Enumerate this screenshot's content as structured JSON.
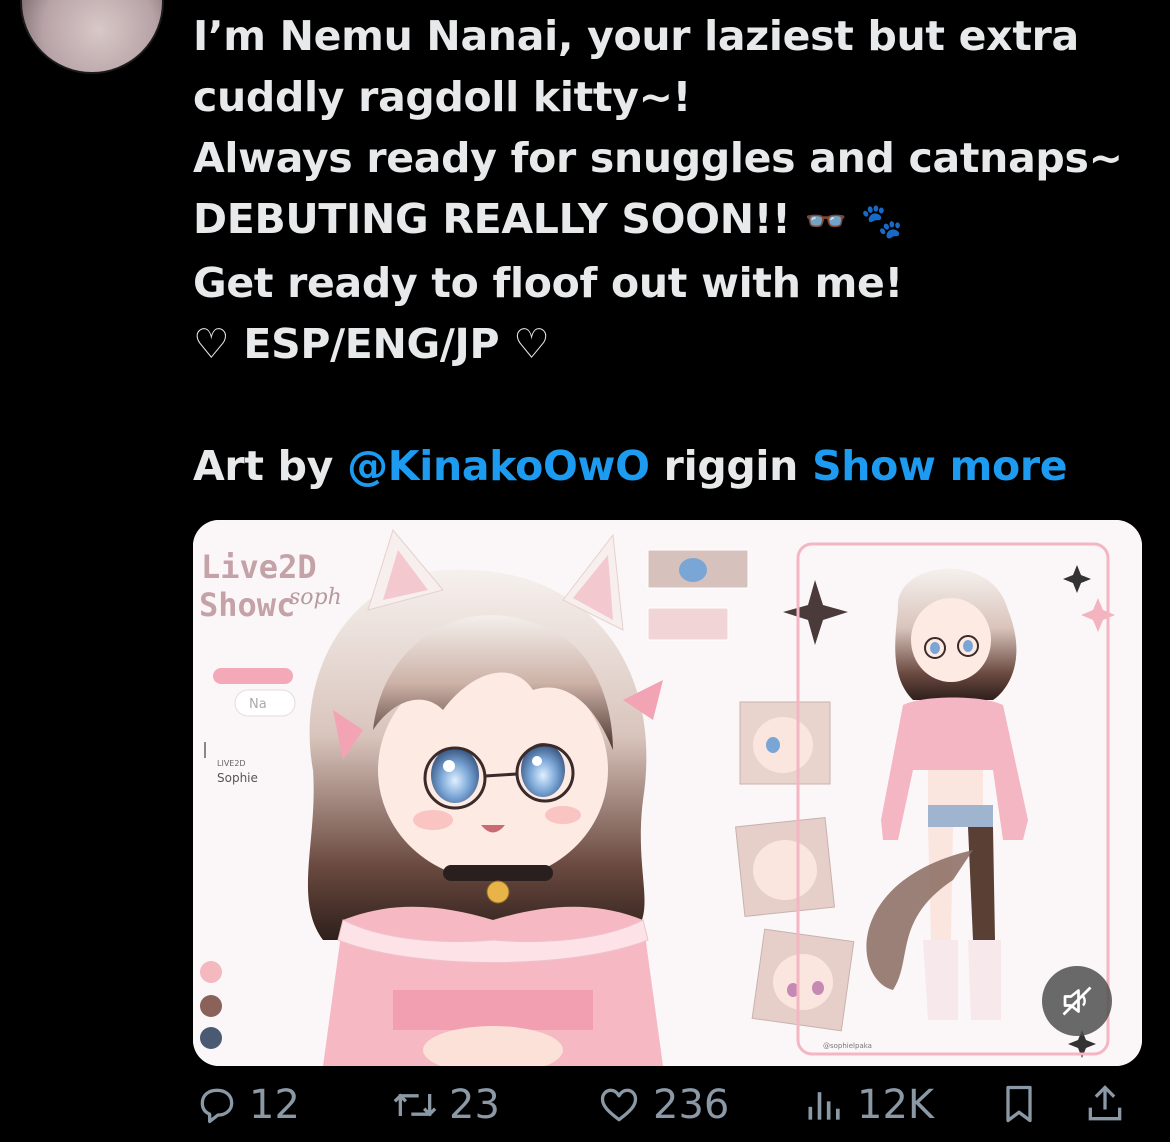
{
  "tweet": {
    "lines": [
      "I’m Nemu Nanai, your laziest but extra",
      "cuddly ragdoll kitty~!",
      "Always ready for snuggles and catnaps~",
      "DEBUTING REALLY SOON!! ",
      "Get ready to floof out with me!",
      "♡ ESP/ENG/JP ♡"
    ],
    "glasses_emoji": "👓",
    "paw_emoji": "🐾",
    "art_by_prefix": "Art by ",
    "mention": "@KinakoOwO",
    "after_mention": " riggin ",
    "show_more": "Show more"
  },
  "media": {
    "title_line1": "Live2D",
    "title_line2": "Showc",
    "script_overlay": "soph",
    "name_field": "Na",
    "credit_small": "LIVE2D",
    "credit_name": "Sophie",
    "watermark": "@sophielpaka",
    "swatches": [
      "#f4b9bf",
      "#8a6259",
      "#4b5a73"
    ]
  },
  "actions": {
    "replies": "12",
    "reposts": "23",
    "likes": "236",
    "views": "12K"
  },
  "colors": {
    "background": "#000000",
    "text": "#e7e9ea",
    "link": "#1d9bf0",
    "muted": "#8b98a5",
    "accent_pink": "#f3a9b8"
  }
}
